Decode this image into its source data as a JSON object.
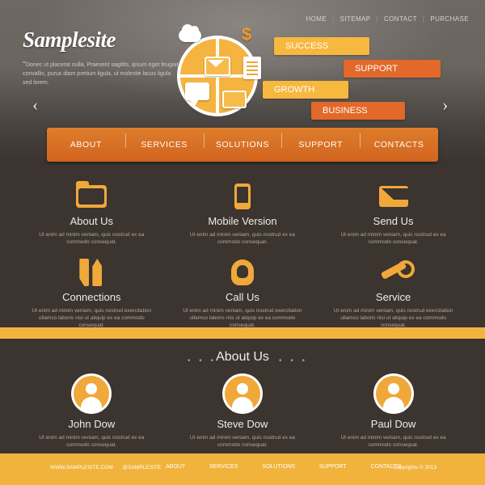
{
  "header": {
    "logo": "Samplesite",
    "tagline_quote": "“",
    "tagline": "Donec ut placerat nulla, Praesent sagittis, ipsum eget feugiat convallis, purus diam pretium ligula, ut molestie lacus ligula sed lorem.",
    "topnav": [
      "HOME",
      "SITEMAP",
      "CONTACT",
      "PURCHASE"
    ],
    "arrow_left": "‹",
    "arrow_right": "›",
    "banners": [
      {
        "label": "SUCCESS",
        "color": "#f6b83f"
      },
      {
        "label": "SUPPORT",
        "color": "#e2692a"
      },
      {
        "label": "GROWTH",
        "color": "#f6b83f"
      },
      {
        "label": "BUSINESS",
        "color": "#e2692a"
      }
    ],
    "globe_icons": [
      "cloud-icon",
      "dollar-icon",
      "envelope-icon",
      "document-icon",
      "chat-bubble-icon",
      "chat-bubble-small-icon"
    ],
    "dollar": "$"
  },
  "mainnav": [
    "ABOUT",
    "SERVICES",
    "SOLUTIONS",
    "SUPPORT",
    "CONTACTS"
  ],
  "services": {
    "lorem_short": "Ut enim ad minim veniam, quis nostrud ex ea commodo consequat.",
    "lorem_long": "Ut enim ad minim veniam, quis nostrud exercitation ullamco laboris nisi ut aliquip ex ea commodo consequat.",
    "items": [
      {
        "title": "About Us",
        "icon": "folder-icon",
        "text": "Ut enim ad minim veniam, quis nostrud ex ea commodo consequat."
      },
      {
        "title": "Mobile Version",
        "icon": "mobile-phone-icon",
        "text": "Ut enim ad minim veniam, quis nostrud ex ea commodo consequat."
      },
      {
        "title": "Send Us",
        "icon": "envelope-icon",
        "text": "Ut enim ad minim veniam, quis nostrud ex ea commodo consequat."
      },
      {
        "title": "Connections",
        "icon": "two-arrows-icon",
        "text": "Ut enim ad minim veniam, quis nostrud exercitation ullamco laboris nisi ut aliquip ex ea commodo consequat."
      },
      {
        "title": "Call Us",
        "icon": "ear-icon",
        "text": "Ut enim ad minim veniam, quis nostrud exercitation ullamco laboris nisi ut aliquip ex ea commodo consequat."
      },
      {
        "title": "Service",
        "icon": "wrench-icon",
        "text": "Ut enim ad minim veniam, quis nostrud exercitation ullamco laboris nisi ut aliquip ex ea commodo consequat."
      }
    ]
  },
  "about": {
    "title": "About Us",
    "dots_left": "• • •",
    "dots_right": "• • •",
    "people": [
      {
        "name": "John Dow",
        "text": "Ut enim ad minim veniam, quis nostrud ex ea commodo consequat."
      },
      {
        "name": "Steve Dow",
        "text": "Ut enim ad minim veniam, quis nostrud ex ea commodo consequat."
      },
      {
        "name": "Paul Dow",
        "text": "Ut enim ad minim veniam, quis nostrud ex ea commodo consequat."
      }
    ]
  },
  "footer": {
    "site": "WWW.SAMPLESITE.COM",
    "twitter": "@SAMPLESITE",
    "links": [
      "ABOUT",
      "SERVICES",
      "SOLUTIONS",
      "SUPPORT",
      "CONTACTS"
    ],
    "copyright": "Copyrights © 2013"
  },
  "colors": {
    "accent_orange": "#f2b33d",
    "accent_dark_orange": "#d2641f",
    "dark_bg": "#3b342f"
  }
}
